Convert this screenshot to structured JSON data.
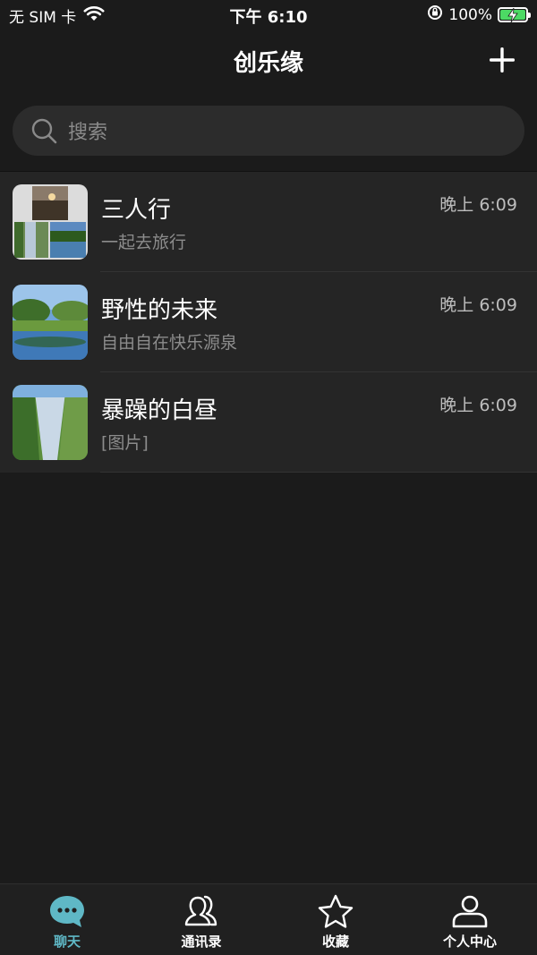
{
  "status_bar": {
    "carrier": "无 SIM 卡",
    "time": "下午 6:10",
    "battery": "100%",
    "battery_level": 1.0
  },
  "nav": {
    "title": "创乐缘"
  },
  "search": {
    "placeholder": "搜索"
  },
  "chats": [
    {
      "name": "三人行",
      "last_message": "一起去旅行",
      "time": "晚上 6:09"
    },
    {
      "name": "野性的未来",
      "last_message": "自由自在快乐源泉",
      "time": "晚上 6:09"
    },
    {
      "name": "暴躁的白昼",
      "last_message": "[图片]",
      "time": "晚上 6:09"
    }
  ],
  "tabs": [
    {
      "label": "聊天",
      "icon": "chat-bubble-icon",
      "active": true
    },
    {
      "label": "通讯录",
      "icon": "contacts-icon",
      "active": false
    },
    {
      "label": "收藏",
      "icon": "star-icon",
      "active": false
    },
    {
      "label": "个人中心",
      "icon": "person-icon",
      "active": false
    }
  ],
  "colors": {
    "accent": "#5fb8c6",
    "background": "#1b1b1b",
    "list_background": "#252525",
    "battery_green": "#4cd964"
  }
}
